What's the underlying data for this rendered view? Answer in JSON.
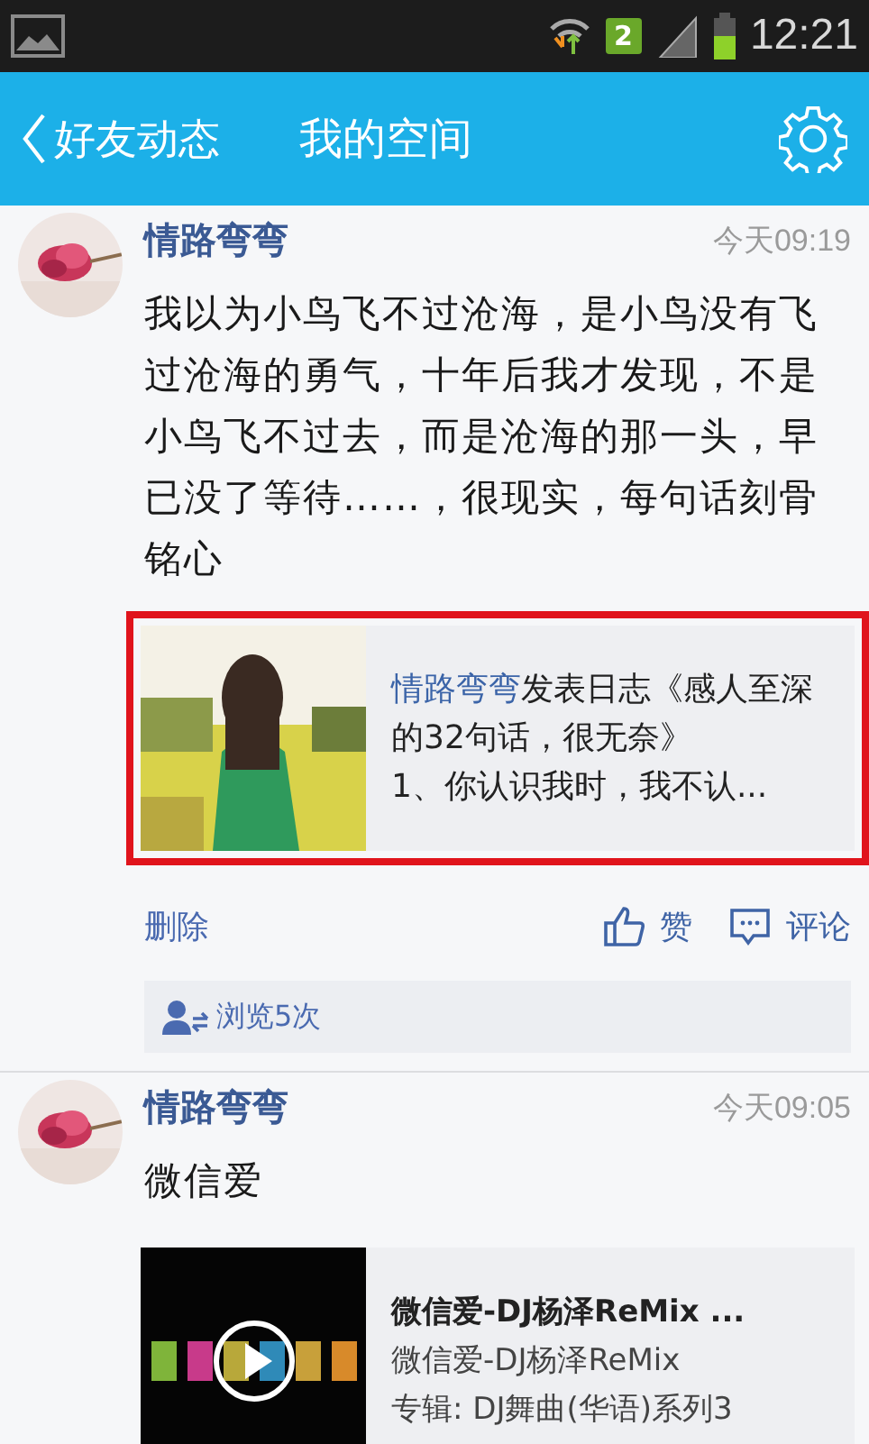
{
  "status_bar": {
    "sim_badge": "2",
    "time": "12:21"
  },
  "header": {
    "back_label": "好友动态",
    "title": "我的空间"
  },
  "posts": [
    {
      "author": "情路弯弯",
      "time": "今天09:19",
      "text": "我以为小鸟飞不过沧海，是小鸟没有飞过沧海的勇气，十年后我才发现，不是小鸟飞不过去，而是沧海的那一头，早已没了等待……，很现实，每句话刻骨铭心",
      "attachment": {
        "kind": "article",
        "highlighted": true,
        "author": "情路弯弯",
        "text": "发表日志《感人至深的32句话，很无奈》",
        "excerpt": "1、你认识我时，我不认..."
      },
      "actions": {
        "delete": "删除",
        "like": "赞",
        "comment": "评论"
      },
      "views": "浏览5次"
    },
    {
      "author": "情路弯弯",
      "time": "今天09:05",
      "text": "微信爱",
      "attachment": {
        "kind": "music",
        "highlighted": false,
        "title": "微信爱-DJ杨泽ReMix ...",
        "subtitle": "微信爱-DJ杨泽ReMix",
        "album": "专辑: DJ舞曲(华语)系列3"
      }
    }
  ]
}
